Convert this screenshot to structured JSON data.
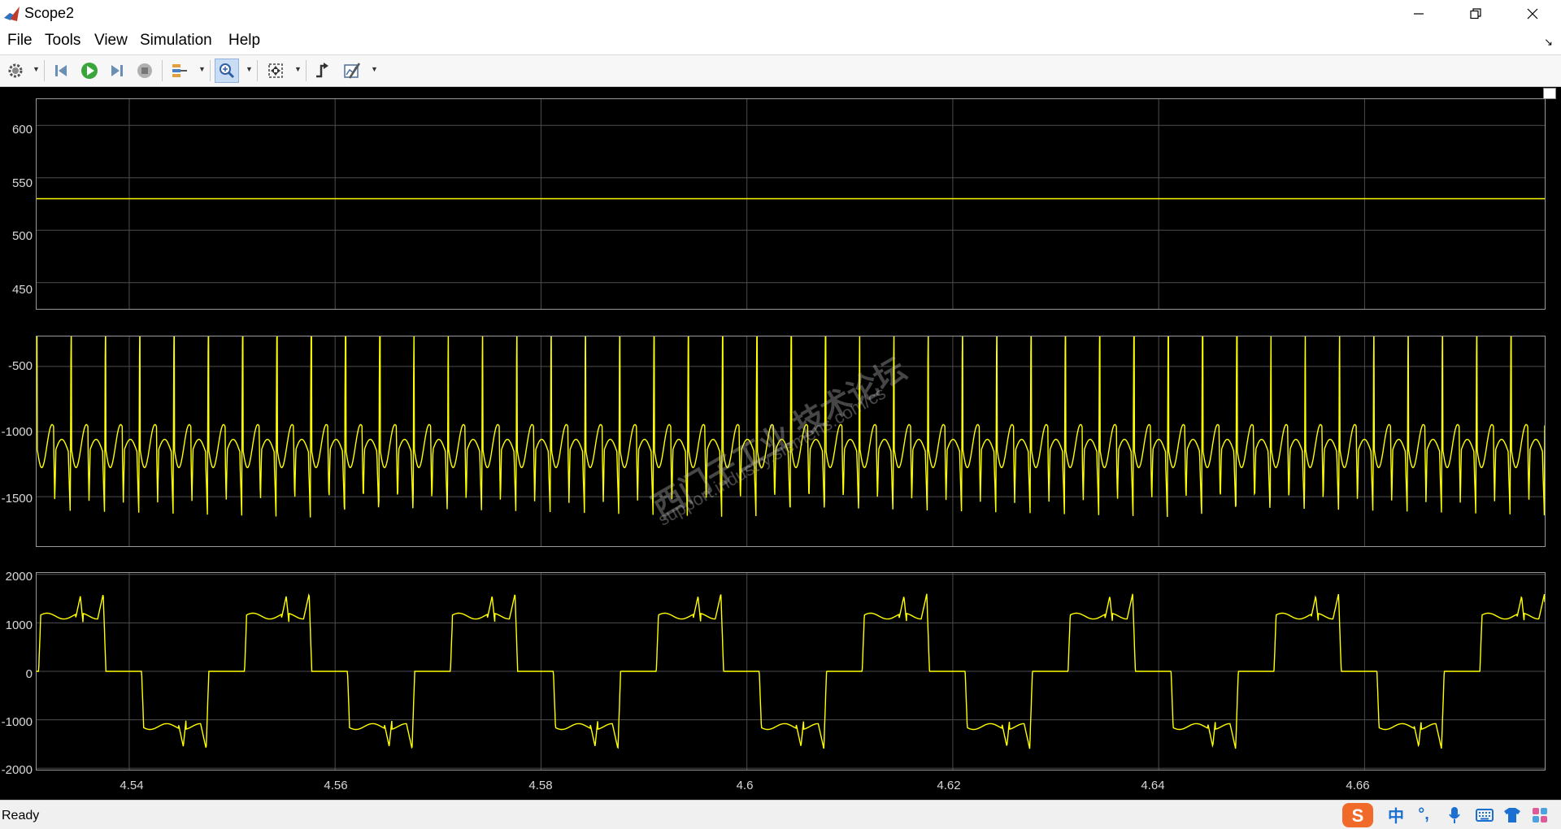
{
  "window": {
    "title": "Scope2"
  },
  "menu": [
    "File",
    "Tools",
    "View",
    "Simulation",
    "Help"
  ],
  "toolbar": {
    "buttons": [
      "settings-icon",
      "step-back-icon",
      "run-icon",
      "step-forward-icon",
      "stop-icon",
      "signal-select-icon",
      "zoom-in-icon",
      "fit-axes-icon",
      "trigger-icon",
      "measurements-icon"
    ],
    "active": "zoom-in-icon"
  },
  "status": {
    "text": "Ready"
  },
  "watermark": {
    "line1": "西门子工业 技术论坛",
    "line2": "support.industry.siemens.com/cs"
  },
  "colors": {
    "trace": "#ffff00",
    "axes_background": "#000000",
    "grid": "#4d4d4d",
    "tick_label": "#d9d9d9"
  },
  "chart_data": [
    {
      "type": "line",
      "xlim": [
        4.531,
        4.6775
      ],
      "ylim": [
        425,
        625
      ],
      "yticks": [
        "600",
        "550",
        "500",
        "450"
      ],
      "ytick_values": [
        600,
        550,
        500,
        450
      ],
      "xtick_values": [
        4.54,
        4.56,
        4.58,
        4.6,
        4.62,
        4.64,
        4.66
      ],
      "series": [
        {
          "x": [
            4.531,
            4.6775
          ],
          "y": [
            530,
            530
          ]
        }
      ]
    },
    {
      "type": "line",
      "xlim": [
        4.531,
        4.6775
      ],
      "ylim": [
        -1880,
        -270
      ],
      "yticks": [
        "-500",
        "-1000",
        "-1500"
      ],
      "ytick_values": [
        -500,
        -1000,
        -1500
      ],
      "xtick_values": [
        4.54,
        4.56,
        4.58,
        4.6,
        4.62,
        4.64,
        4.66
      ],
      "period_s": 0.00333,
      "baseline": -1100,
      "spike_max": -480,
      "spike_min": -1660,
      "series": [
        {
          "x": [
            4.531,
            4.532,
            4.5335,
            4.5343,
            4.5345,
            4.535,
            4.536,
            4.537,
            4.5376,
            4.5378,
            4.5385,
            4.5395
          ],
          "y": [
            -1050,
            -1200,
            -1500,
            -1660,
            -480,
            -950,
            -1180,
            -1100,
            -1640,
            -500,
            -1050,
            -1150
          ]
        }
      ]
    },
    {
      "type": "line",
      "xlim": [
        4.531,
        4.6775
      ],
      "ylim": [
        -2030,
        2030
      ],
      "yticks": [
        "2000",
        "1000",
        "0",
        "-1000",
        "-2000"
      ],
      "ytick_values": [
        2000,
        1000,
        0,
        -1000,
        -2000
      ],
      "xticks": [
        "4.54",
        "4.56",
        "4.58",
        "4.6",
        "4.62",
        "4.64",
        "4.66"
      ],
      "xtick_values": [
        4.54,
        4.56,
        4.58,
        4.6,
        4.62,
        4.64,
        4.66
      ],
      "period_s": 0.02,
      "levels": [
        1100,
        0,
        -1100,
        0
      ],
      "peak": 1650,
      "series": [
        {
          "x": [
            4.5312,
            4.532,
            4.5345,
            4.5385,
            4.5393,
            4.5463,
            4.5533,
            4.5593
          ],
          "y": [
            0,
            1150,
            1640,
            1620,
            0,
            -1150,
            -1620,
            0
          ]
        }
      ]
    }
  ]
}
